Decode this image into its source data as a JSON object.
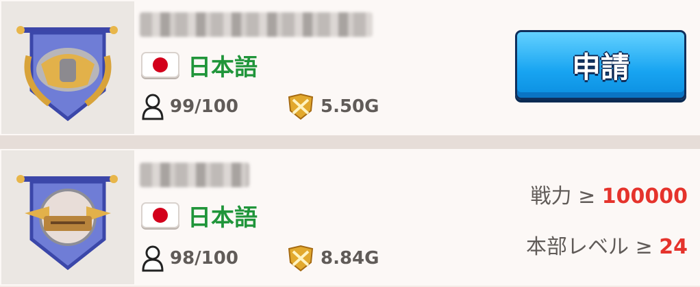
{
  "clans": [
    {
      "emblem": "gauntlets-crest-icon",
      "language": {
        "flag": "japan-flag-icon",
        "label": "日本語"
      },
      "members": "99/100",
      "power": "5.50G",
      "action": {
        "label": "申請"
      }
    },
    {
      "emblem": "helmet-crest-icon",
      "language": {
        "flag": "japan-flag-icon",
        "label": "日本語"
      },
      "members": "98/100",
      "power": "8.84G",
      "requirements": [
        {
          "label": "戦力 ≥ ",
          "value": "100000"
        },
        {
          "label": "本部レベル ≥ ",
          "value": "24"
        }
      ]
    }
  ],
  "colors": {
    "language_text": "#20953a",
    "requirement_value": "#e5332c",
    "apply_button": "#18a4f1"
  }
}
